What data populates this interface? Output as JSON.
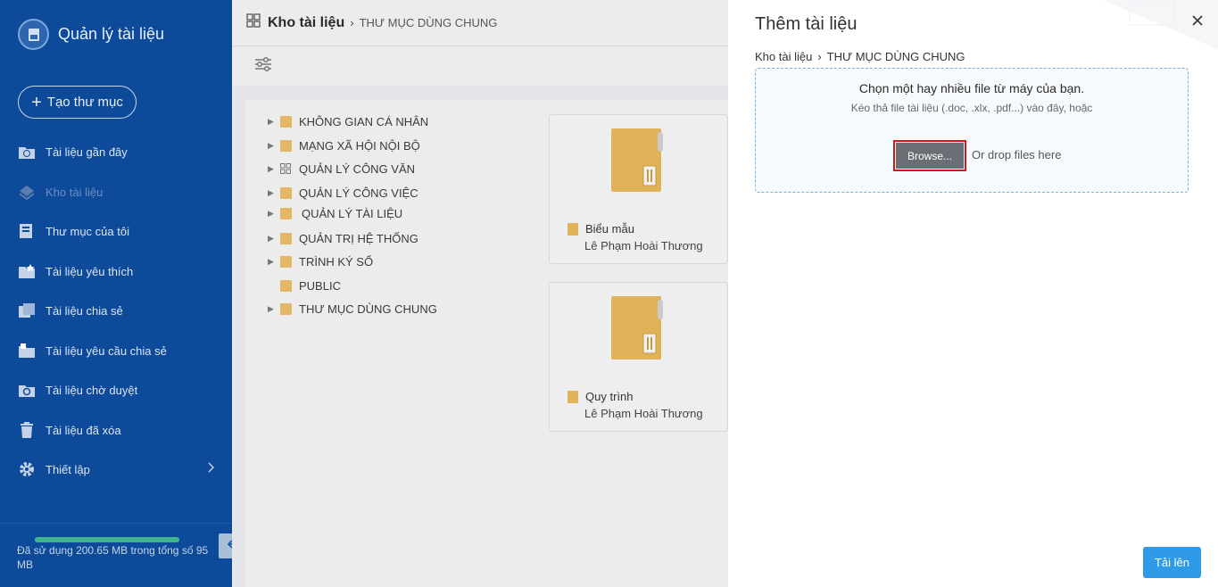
{
  "sidebar": {
    "app_title": "Quản lý tài liệu",
    "create_label": "Tạo thư mục",
    "items": [
      {
        "label": "Tài liệu gần đây",
        "icon": "recent-folder-icon"
      },
      {
        "label": "Kho tài liệu",
        "icon": "storage-icon"
      },
      {
        "label": "Thư mục của tôi",
        "icon": "my-folder-icon"
      },
      {
        "label": "Tài liệu yêu thích",
        "icon": "favorite-folder-icon"
      },
      {
        "label": "Tài liệu chia sẻ",
        "icon": "shared-folder-icon"
      },
      {
        "label": "Tài liệu yêu cầu chia sẻ",
        "icon": "request-share-icon"
      },
      {
        "label": "Tài liệu chờ duyệt",
        "icon": "pending-folder-icon"
      },
      {
        "label": "Tài liệu đã xóa",
        "icon": "trash-icon"
      },
      {
        "label": "Thiết lập",
        "icon": "gear-icon"
      }
    ],
    "usage_text": "Đã sử dụng 200.65 MB trong tổng số 95 MB",
    "usage_fraction": 1.0
  },
  "main": {
    "breadcrumb_root": "Kho tài liệu",
    "breadcrumb_current": "THƯ MỤC DÙNG CHUNG",
    "tree": [
      "KHÔNG GIAN CÁ NHÂN",
      "MẠNG XÃ HỘI NỘI BỘ",
      "QUẢN LÝ CÔNG VĂN",
      "QUẢN LÝ CÔNG VIỆC",
      "QUẢN LÝ TÀI LIỆU",
      "QUẢN TRỊ HỆ THỐNG",
      "TRÌNH KÝ SỐ",
      "PUBLIC",
      "THƯ MỤC DÙNG CHUNG"
    ],
    "cards": [
      {
        "title": "Biểu mẫu",
        "owner": "Lê Phạm Hoài Thương"
      },
      {
        "title": "Quy trình",
        "owner": "Lê Phạm Hoài Thương"
      }
    ]
  },
  "panel": {
    "title": "Thêm tài liệu",
    "breadcrumb_root": "Kho tài liệu",
    "breadcrumb_current": "THƯ MỤC DÙNG CHUNG",
    "dropzone_title": "Chọn một hay nhiều file từ máy của bạn.",
    "dropzone_subtitle": "Kéo thả file tài liệu (.doc, .xlx, .pdf...) vào đây, hoặc",
    "browse_label": "Browse...",
    "drop_hint": "Or drop files here",
    "upload_label": "Tải lên"
  },
  "colors": {
    "sidebar_bg": "#0d4a9a",
    "accent": "#2f9be8",
    "folder": "#e2b766",
    "highlight_border": "#d9141a"
  }
}
